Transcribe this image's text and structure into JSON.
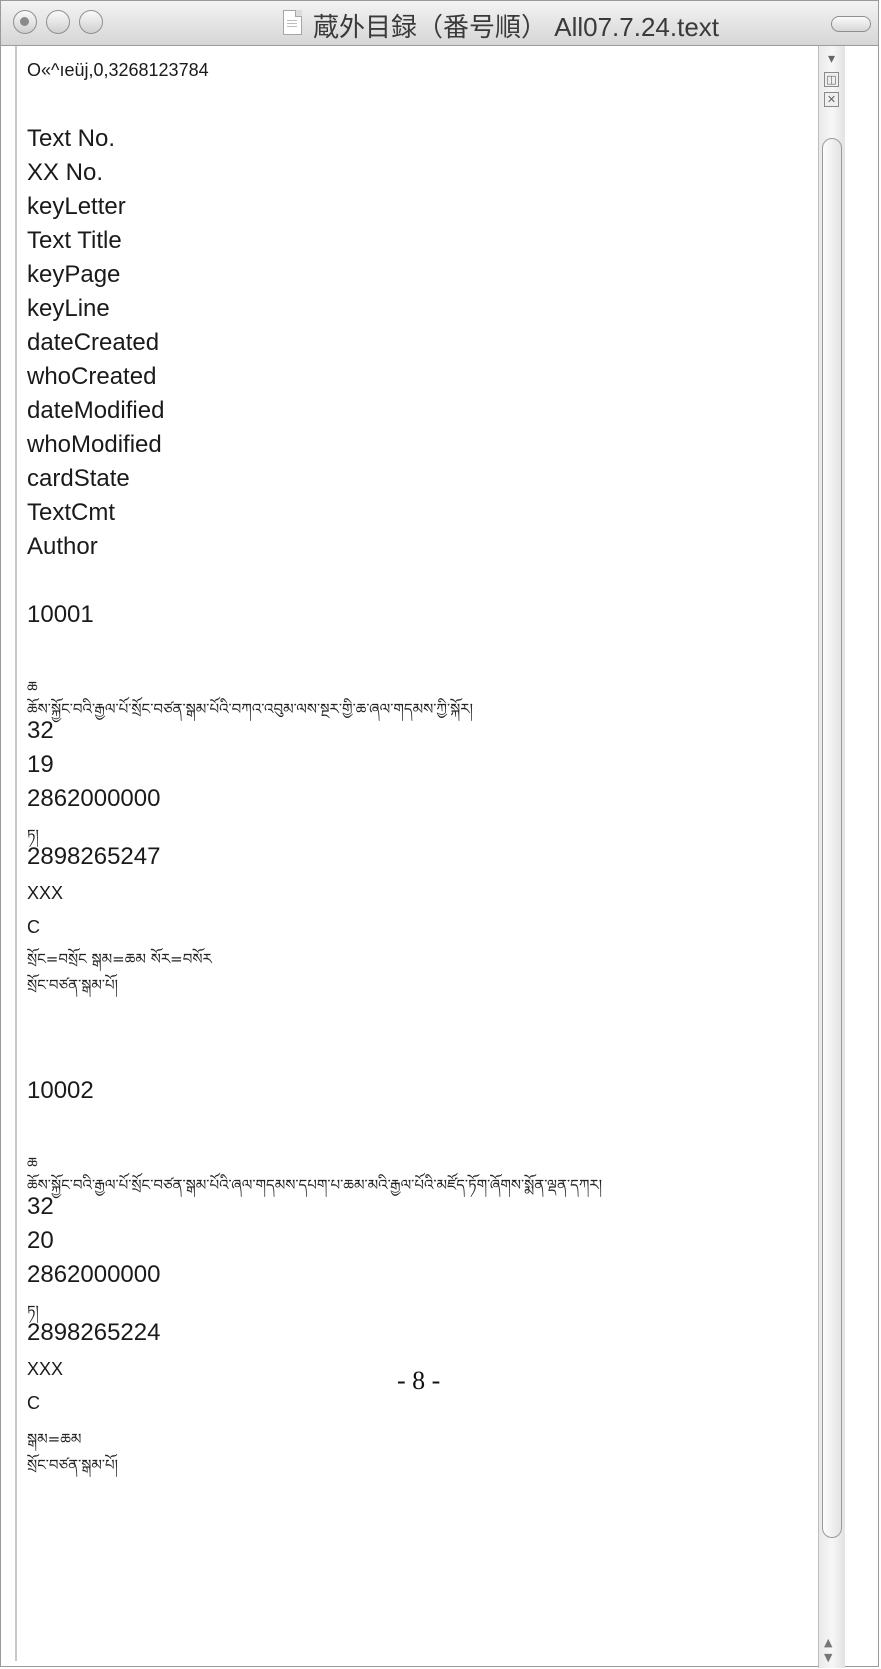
{
  "window": {
    "title": "蔵外目録（番号順） All07.7.24.text"
  },
  "document": {
    "header_line": "O«^ıeüj,0,3268123784",
    "field_names": [
      "Text No.",
      "XX No.",
      "keyLetter",
      "Text Title",
      "keyPage",
      "keyLine",
      "dateCreated",
      "whoCreated",
      "dateModified",
      "whoModified",
      "cardState",
      "TextCmt",
      "Author"
    ],
    "record1": {
      "text_no": "10001",
      "key_letter": "ཆ",
      "title": "ཆོས་སྐྱོང་བའི་རྒྱལ་པོ་སྲོང་བཙན་སྒམ་པོའི་བཀའ་འབུམ་ལས་སྔར་གྱི་ཆ་ཞལ་གདམས་ཀྱི་སྐོར།",
      "key_page": "32",
      "key_line": "19",
      "date_created": "2862000000",
      "who_created": "ཏ།",
      "date_modified": "2898265247",
      "who_modified": "XXX",
      "card_state": "C",
      "text_cmt": "སྲོང=བསྲོང  སྒམ=ཆམ  སོར=བསོར",
      "author": "སྲོང་བཙན་སྒམ་པོ།"
    },
    "record2": {
      "text_no": "10002",
      "key_letter": "ཆ",
      "title": "ཆོས་སྐྱོང་བའི་རྒྱལ་པོ་སྲོང་བཙན་སྒམ་པོའི་ཞལ་གདམས་དཔག་པ་ཆམ་མའི་རྒྱལ་པོའི་མཛོད་ཏོག་ཞོགས་སྨོན་ལྡན་དཀར།",
      "key_page": "32",
      "key_line": "20",
      "date_created": "2862000000",
      "who_created": "ཏ།",
      "date_modified": "2898265224",
      "who_modified": "XXX",
      "card_state": "C",
      "text_cmt": "སྒམ=ཆམ",
      "author": "སྲོང་བཙན་སྒམ་པོ།"
    },
    "page_number": "- 8 -"
  }
}
